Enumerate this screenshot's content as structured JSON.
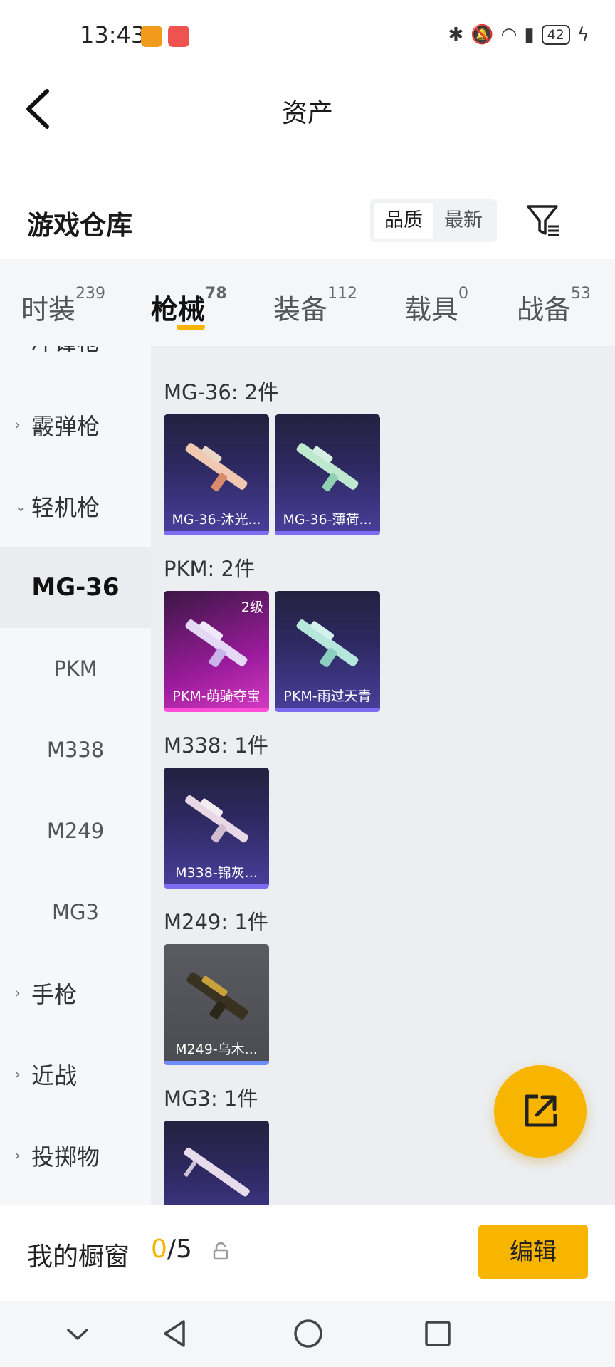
{
  "status_bar": {
    "time": "13:43",
    "app_icon_colors": [
      "#f29a1c",
      "#ef5350"
    ],
    "battery": "42",
    "icons": [
      "bluetooth-icon",
      "mute-icon",
      "wifi-icon",
      "battery-saver-icon",
      "battery-icon",
      "charging-icon"
    ]
  },
  "header": {
    "title": "资产"
  },
  "section": {
    "title": "游戏仓库",
    "sort_options": [
      "品质",
      "最新"
    ],
    "active_sort": "品质"
  },
  "tabs": [
    {
      "label": "时装",
      "count": "239",
      "active": false
    },
    {
      "label": "枪械",
      "count": "78",
      "active": true
    },
    {
      "label": "装备",
      "count": "112",
      "active": false
    },
    {
      "label": "载具",
      "count": "0",
      "active": false
    },
    {
      "label": "战备",
      "count": "53",
      "active": false
    }
  ],
  "sidebar": {
    "items": [
      {
        "label": "冲锋枪",
        "type": "category",
        "expanded": false
      },
      {
        "label": "霰弹枪",
        "type": "category",
        "expanded": false
      },
      {
        "label": "轻机枪",
        "type": "category",
        "expanded": true
      },
      {
        "label": "MG-36",
        "type": "sub",
        "selected": true
      },
      {
        "label": "PKM",
        "type": "sub",
        "selected": false
      },
      {
        "label": "M338",
        "type": "sub",
        "selected": false
      },
      {
        "label": "M249",
        "type": "sub",
        "selected": false
      },
      {
        "label": "MG3",
        "type": "sub",
        "selected": false
      },
      {
        "label": "手枪",
        "type": "category",
        "expanded": false
      },
      {
        "label": "近战",
        "type": "category",
        "expanded": false
      },
      {
        "label": "投掷物",
        "type": "category",
        "expanded": false
      }
    ]
  },
  "groups": [
    {
      "title": "MG-36: 2件",
      "items": [
        {
          "name": "MG-36-沐光...",
          "style": "purple",
          "badge": ""
        },
        {
          "name": "MG-36-薄荷...",
          "style": "purple",
          "badge": ""
        }
      ]
    },
    {
      "title": "PKM: 2件",
      "items": [
        {
          "name": "PKM-萌骑夺宝",
          "style": "pink",
          "badge": "2级"
        },
        {
          "name": "PKM-雨过天青",
          "style": "purple",
          "badge": ""
        }
      ]
    },
    {
      "title": "M338: 1件",
      "items": [
        {
          "name": "M338-锦灰...",
          "style": "purple",
          "badge": ""
        }
      ]
    },
    {
      "title": "M249: 1件",
      "items": [
        {
          "name": "M249-乌木...",
          "style": "gray",
          "badge": ""
        }
      ]
    },
    {
      "title": "MG3: 1件",
      "items": [
        {
          "name": "",
          "style": "purple",
          "badge": ""
        }
      ]
    }
  ],
  "showcase": {
    "title": "我的橱窗",
    "current": "0",
    "total": "/5",
    "edit_label": "编辑"
  },
  "colors": {
    "accent": "#f7b500",
    "purple_bar": "#7b6cf0",
    "pink_bar": "#ff4fd8",
    "gray_bar": "#6f8cff"
  }
}
